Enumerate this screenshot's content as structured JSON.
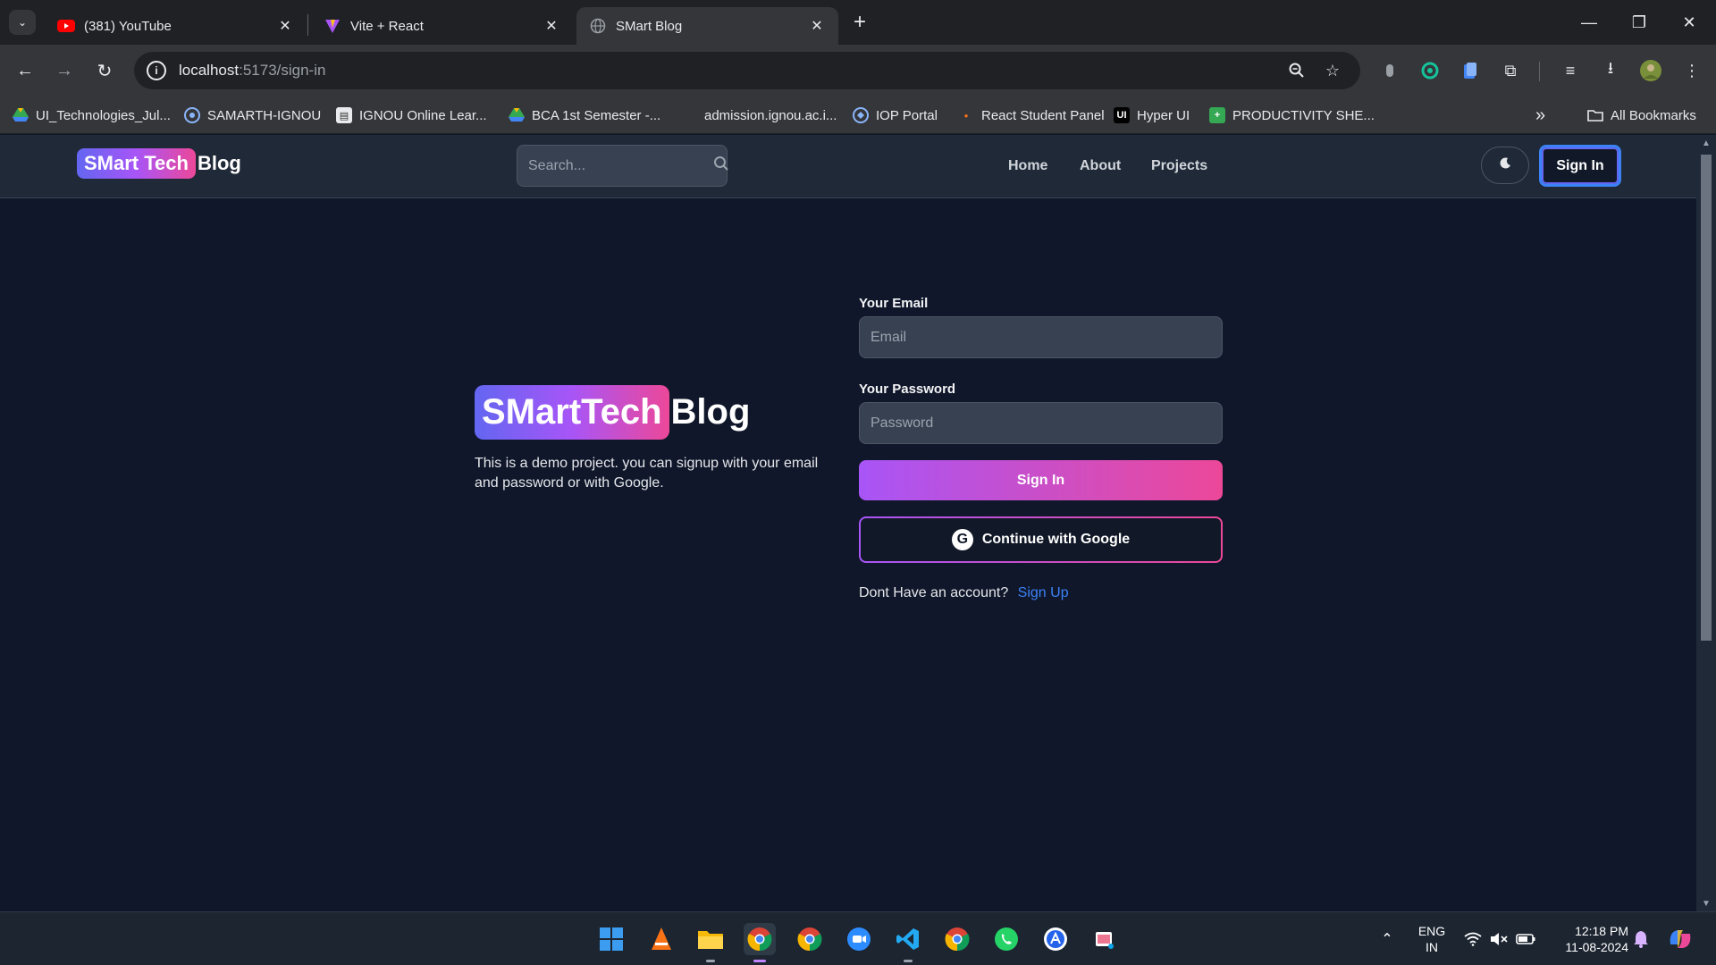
{
  "browser": {
    "tabs": [
      {
        "title": "(381) YouTube",
        "active": false
      },
      {
        "title": "Vite + React",
        "active": false
      },
      {
        "title": "SMart Blog",
        "active": true
      }
    ],
    "url_host": "localhost",
    "url_path": ":5173/sign-in",
    "bookmarks": [
      "UI_Technologies_Jul...",
      "SAMARTH-IGNOU",
      "IGNOU Online Lear...",
      "BCA 1st Semester -...",
      "admission.ignou.ac.i...",
      "IOP Portal",
      "React Student Panel",
      "Hyper UI",
      "PRODUCTIVITY SHE..."
    ],
    "all_bookmarks": "All Bookmarks",
    "more_bookmarks": "»"
  },
  "header": {
    "logo_highlight": "SMart Tech",
    "logo_rest": "Blog",
    "search_placeholder": "Search...",
    "nav": [
      "Home",
      "About",
      "Projects"
    ],
    "signin_label": "Sign In"
  },
  "hero": {
    "logo_highlight": "SMartTech",
    "logo_rest": "Blog",
    "description": "This is a demo project. you can signup with your email and password or with Google."
  },
  "form": {
    "email_label": "Your Email",
    "email_placeholder": "Email",
    "password_label": "Your Password",
    "password_placeholder": "Password",
    "signin_button": "Sign In",
    "google_button": "Continue with Google",
    "account_prompt": "Dont Have an account?",
    "signup_link": "Sign Up"
  },
  "taskbar": {
    "lang_top": "ENG",
    "lang_bottom": "IN",
    "time": "12:18 PM",
    "date": "11-08-2024"
  },
  "colors": {
    "page_bg": "#10172a",
    "header_bg": "#1f2937",
    "gradient_start": "#a855f7",
    "gradient_end": "#ec4899",
    "link": "#3b82f6"
  }
}
